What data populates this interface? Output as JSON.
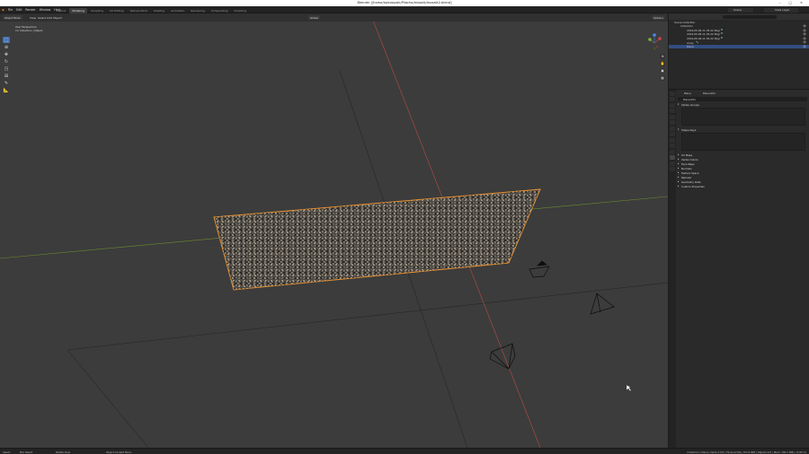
{
  "window": {
    "title": "Blender [/home/kpirosszak/Pliocha/mosaik/mosaik2.blend]",
    "controls": "– ▢ ×"
  },
  "menu": [
    "File",
    "Edit",
    "Render",
    "Window",
    "Help"
  ],
  "workspaces": [
    "Layout",
    "Modeling",
    "Sculpting",
    "UV Editing",
    "Texture Paint",
    "Shading",
    "Animation",
    "Rendering",
    "Compositing",
    "Scripting"
  ],
  "active_workspace_index": 1,
  "scene_name": "Scene",
  "view_layer": "View Layer",
  "viewport_header": {
    "mode": "Object Mode",
    "view": "View",
    "select": "Select",
    "add": "Add",
    "object": "Object",
    "orientation": "Global",
    "options": "Options"
  },
  "viewport_info": {
    "line1": "User Perspective",
    "line2": "(1) Collection | Object"
  },
  "tools": [
    "select",
    "cursor",
    "move",
    "rotate",
    "scale",
    "transform",
    "annotate",
    "measure"
  ],
  "outliner": {
    "rows": [
      {
        "label": "Scene Collection",
        "indent": 1
      },
      {
        "label": "Collection",
        "indent": 2
      },
      {
        "label": "2019-05-09 11-35-22.5bgr",
        "indent": 3
      },
      {
        "label": "2019-05-09 11-35-22.5bgr",
        "indent": 3
      },
      {
        "label": "2019-05-09 11-35-22.5bgr",
        "indent": 3
      },
      {
        "label": "Array",
        "indent": 3
      },
      {
        "label": "Plane",
        "indent": 3
      }
    ],
    "selected_index": 6
  },
  "properties": {
    "data_tab": "Plane",
    "data_tab2": "Plane.001",
    "mesh_name": "Plane.001",
    "panels": [
      "Vertex Groups",
      "Shape Keys",
      "UV Maps",
      "Vertex Colors",
      "Face Maps",
      "Normals",
      "Texture Space",
      "Remesh",
      "Geometry Data",
      "Custom Properties"
    ]
  },
  "statusbar": {
    "left1": "Select",
    "left2": "Box Select",
    "left3": "Rotate View",
    "left4": "Object Context Menu",
    "right": "Collection | Plane | Verts:4,721 | Faces:4,504 | Tris:9,008 | Objects:1/5 | Mem: 136.1 MiB | v2.80.74"
  },
  "colors": {
    "selection_orange": "#e8902f",
    "accent_blue": "#4772b3",
    "axis_red": "#b84a4a",
    "axis_green": "#6c8b2c"
  }
}
